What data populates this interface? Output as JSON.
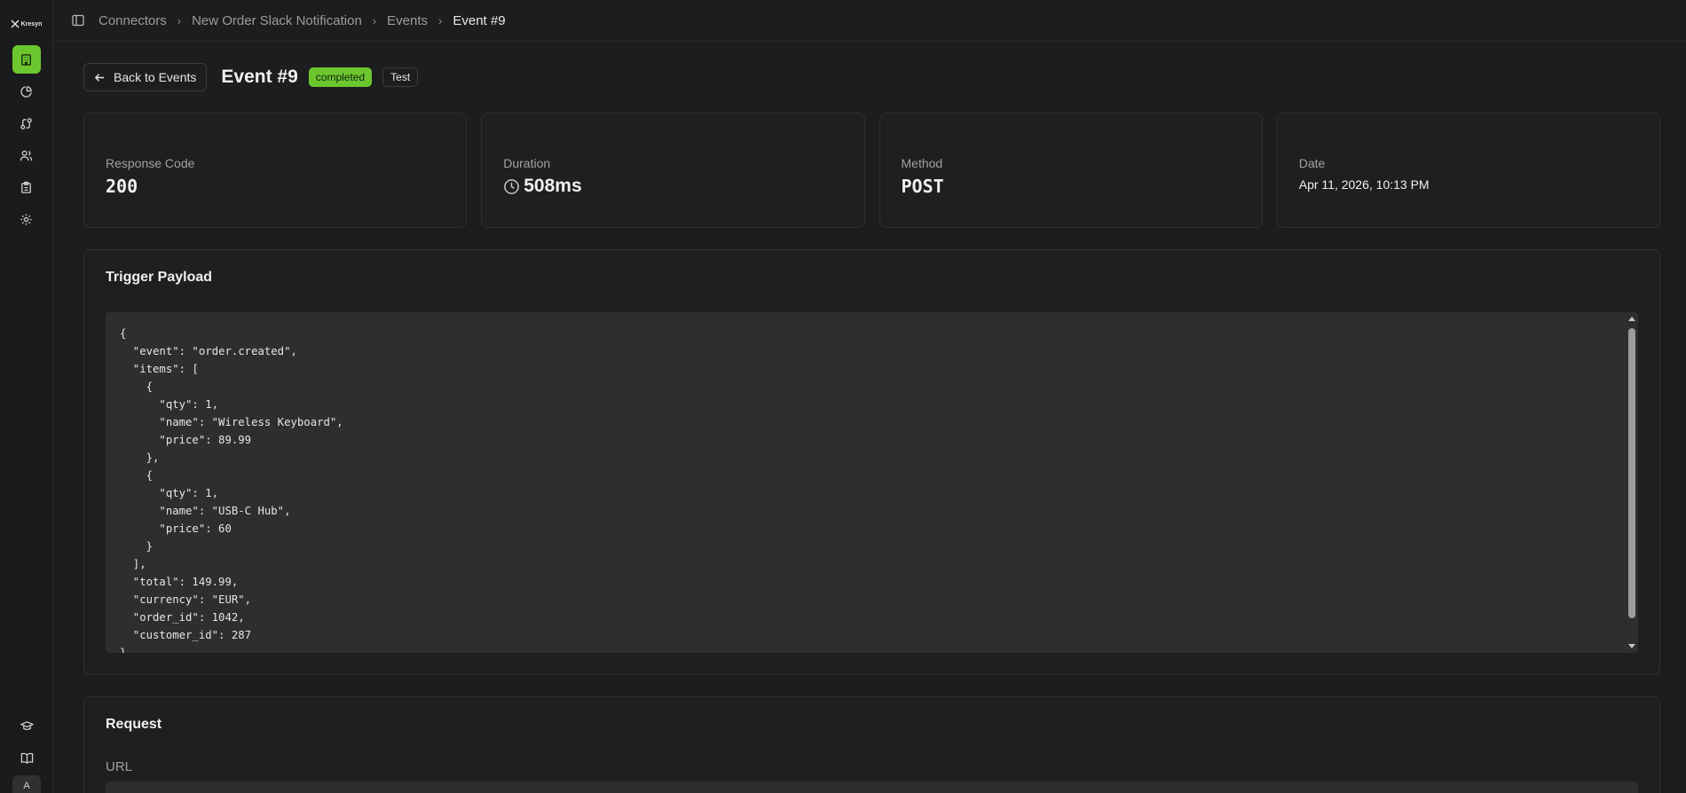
{
  "app": {
    "logo_text": "Kresyn"
  },
  "sidebar": {
    "items": [
      {
        "icon": "building-icon",
        "active": true
      },
      {
        "icon": "pie-chart-icon"
      },
      {
        "icon": "route-icon"
      },
      {
        "icon": "users-icon"
      },
      {
        "icon": "clipboard-icon"
      },
      {
        "icon": "gear-icon"
      }
    ],
    "bottom": [
      {
        "icon": "graduation-cap-icon"
      },
      {
        "icon": "book-icon"
      }
    ],
    "avatar_initial": "A"
  },
  "breadcrumb": {
    "items": [
      "Connectors",
      "New Order Slack Notification",
      "Events",
      "Event #9"
    ]
  },
  "header": {
    "back_label": "Back to Events",
    "title": "Event #9",
    "status_badge": "completed",
    "test_badge": "Test"
  },
  "stats": {
    "response_code": {
      "label": "Response Code",
      "value": "200"
    },
    "duration": {
      "label": "Duration",
      "value": "508ms"
    },
    "method": {
      "label": "Method",
      "value": "POST"
    },
    "date": {
      "label": "Date",
      "value": "Apr 11, 2026, 10:13 PM"
    }
  },
  "payload": {
    "title": "Trigger Payload",
    "json": "{\n  \"event\": \"order.created\",\n  \"items\": [\n    {\n      \"qty\": 1,\n      \"name\": \"Wireless Keyboard\",\n      \"price\": 89.99\n    },\n    {\n      \"qty\": 1,\n      \"name\": \"USB-C Hub\",\n      \"price\": 60\n    }\n  ],\n  \"total\": 149.99,\n  \"currency\": \"EUR\",\n  \"order_id\": 1042,\n  \"customer_id\": 287\n}"
  },
  "request": {
    "title": "Request",
    "url_label": "URL"
  },
  "colors": {
    "accent": "#6cc72f",
    "background": "#1c1d1e",
    "card": "#1e1f20",
    "code_bg": "#2c2e30"
  }
}
